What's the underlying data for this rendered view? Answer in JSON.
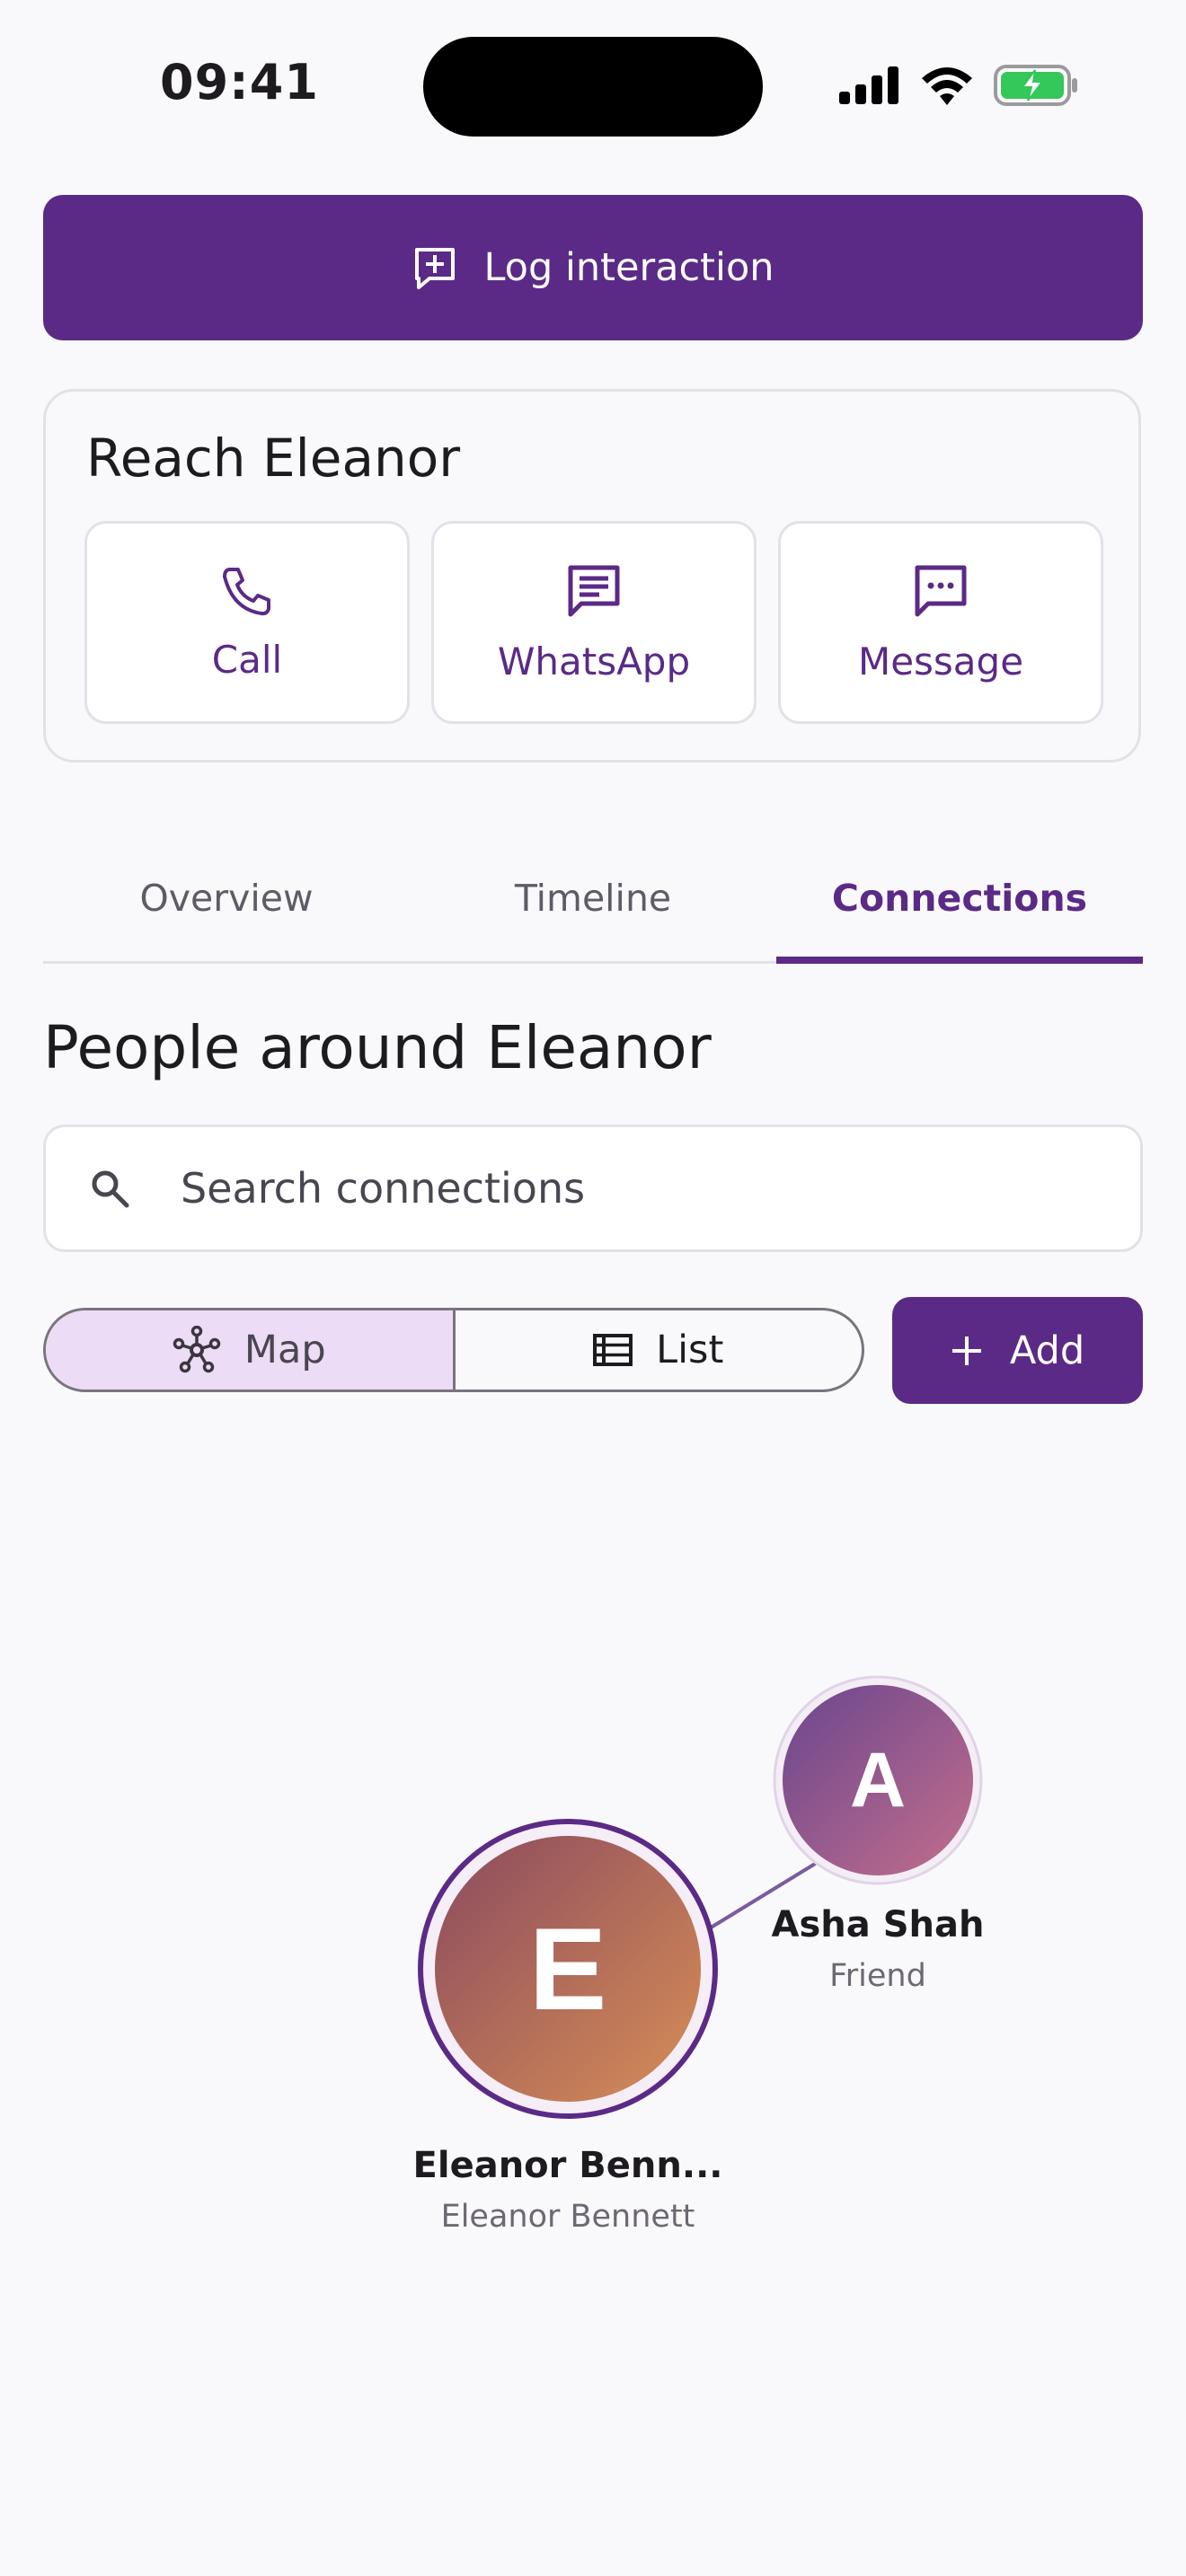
{
  "status_bar": {
    "time": "09:41"
  },
  "actions": {
    "log_interaction": "Log interaction"
  },
  "reach": {
    "title": "Reach Eleanor",
    "buttons": [
      {
        "label": "Call",
        "icon": "phone-icon"
      },
      {
        "label": "WhatsApp",
        "icon": "chat-lines-icon"
      },
      {
        "label": "Message",
        "icon": "message-dots-icon"
      }
    ]
  },
  "tabs": [
    {
      "label": "Overview",
      "active": false
    },
    {
      "label": "Timeline",
      "active": false
    },
    {
      "label": "Connections",
      "active": true
    }
  ],
  "connections": {
    "title": "People around Eleanor",
    "search": {
      "placeholder": "Search connections",
      "value": ""
    },
    "view_toggle": [
      {
        "label": "Map",
        "icon": "network-icon",
        "selected": true
      },
      {
        "label": "List",
        "icon": "list-icon",
        "selected": false
      }
    ],
    "add_label": "Add",
    "map": {
      "center": {
        "initial": "E",
        "name": "Eleanor Benn...",
        "subtitle": "Eleanor Bennett"
      },
      "nodes": [
        {
          "initial": "A",
          "name": "Asha Shah",
          "relation": "Friend"
        }
      ]
    }
  },
  "colors": {
    "primary": "#5b2a86",
    "background": "#f9f9fc",
    "segment_selected": "#ecdcf5",
    "battery_charging": "#34c759"
  }
}
